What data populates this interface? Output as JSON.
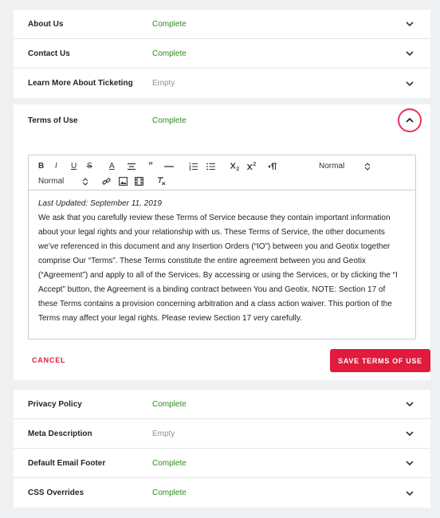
{
  "top_sections": [
    {
      "name": "About Us",
      "status": "Complete",
      "status_type": "complete"
    },
    {
      "name": "Contact Us",
      "status": "Complete",
      "status_type": "complete"
    },
    {
      "name": "Learn More About Ticketing",
      "status": "Empty",
      "status_type": "empty"
    }
  ],
  "expanded_section": {
    "name": "Terms of Use",
    "status": "Complete",
    "collapse_icon": "chevron-up-icon",
    "toolbar": {
      "bold": "B",
      "italic": "I",
      "underline": "U",
      "strike": "S",
      "font_color": "A",
      "quote": "”",
      "header_select": "Normal",
      "size_select": "Normal"
    },
    "content": {
      "updated": "Last Updated: September 11, 2019",
      "body": "We ask that you carefully review these Terms of Service because they contain important information about your legal rights and your relationship with us. These Terms of Service, the other documents we’ve referenced in this document and any Insertion Orders (“IO”) between you and Geotix together comprise Our “Terms”. These Terms constitute the entire agreement between you and Geotix (“Agreement”) and apply to all of the Services. By accessing or using the Services, or by clicking the “I Accept” button, the Agreement is a binding contract between You and Geotix. NOTE: Section 17 of these Terms contains a provision concerning arbitration and a class action waiver. This portion of the Terms may affect your legal rights. Please review Section 17 very carefully."
    },
    "cancel_label": "CANCEL",
    "save_label": "SAVE TERMS OF USE"
  },
  "bottom_sections": [
    {
      "name": "Privacy Policy",
      "status": "Complete",
      "status_type": "complete"
    },
    {
      "name": "Meta Description",
      "status": "Empty",
      "status_type": "empty"
    },
    {
      "name": "Default Email Footer",
      "status": "Complete",
      "status_type": "complete"
    },
    {
      "name": "CSS Overrides",
      "status": "Complete",
      "status_type": "complete"
    }
  ],
  "colors": {
    "accent": "#e01b3c",
    "complete": "#2e8b1e",
    "empty": "#8a8f96",
    "highlight_ring": "#e8315b"
  }
}
